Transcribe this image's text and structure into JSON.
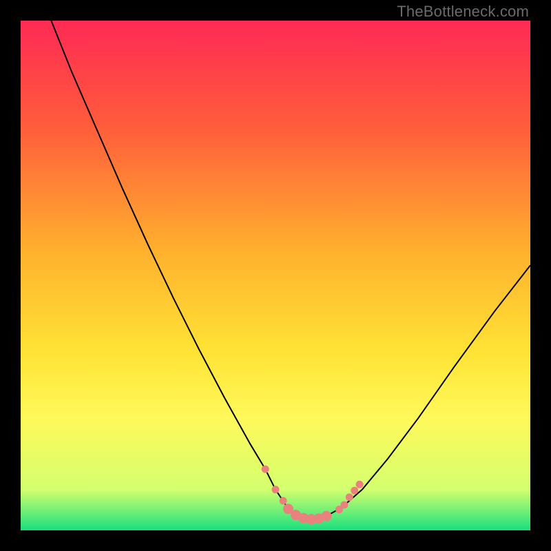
{
  "watermark": "TheBottleneck.com",
  "chart_data": {
    "type": "line",
    "title": "",
    "xlabel": "",
    "ylabel": "",
    "xlim": [
      0,
      100
    ],
    "ylim": [
      0,
      100
    ],
    "gradient_stops": [
      {
        "offset": 0,
        "color": "#ff2a55"
      },
      {
        "offset": 0.2,
        "color": "#ff5a3c"
      },
      {
        "offset": 0.45,
        "color": "#ffb02e"
      },
      {
        "offset": 0.65,
        "color": "#ffe335"
      },
      {
        "offset": 0.78,
        "color": "#fff95a"
      },
      {
        "offset": 0.92,
        "color": "#d4ff6e"
      },
      {
        "offset": 1.0,
        "color": "#18e07e"
      }
    ],
    "series": [
      {
        "name": "bottleneck-curve",
        "style": "thin-black",
        "x": [
          6,
          10,
          15,
          20,
          25,
          30,
          35,
          40,
          45,
          48,
          50,
          52,
          54,
          56,
          58,
          60,
          63,
          67,
          72,
          78,
          85,
          93,
          100
        ],
        "y": [
          100,
          90,
          78.5,
          67,
          56,
          45.5,
          35.5,
          26,
          17,
          12,
          8,
          5,
          3,
          2.3,
          2.2,
          2.8,
          4.5,
          8,
          14,
          22,
          32,
          43,
          52
        ]
      }
    ],
    "markers": {
      "name": "highlight-dots",
      "color": "#e9817e",
      "radius_small": 5.5,
      "radius_large": 7.5,
      "points": [
        {
          "x": 48.0,
          "y": 12.0,
          "r": "small"
        },
        {
          "x": 50.0,
          "y": 8.0,
          "r": "small"
        },
        {
          "x": 51.5,
          "y": 5.8,
          "r": "small"
        },
        {
          "x": 52.5,
          "y": 4.2,
          "r": "large"
        },
        {
          "x": 54.0,
          "y": 3.0,
          "r": "large"
        },
        {
          "x": 55.5,
          "y": 2.4,
          "r": "large"
        },
        {
          "x": 57.0,
          "y": 2.2,
          "r": "large"
        },
        {
          "x": 58.5,
          "y": 2.3,
          "r": "large"
        },
        {
          "x": 60.0,
          "y": 2.8,
          "r": "large"
        },
        {
          "x": 62.5,
          "y": 4.1,
          "r": "small"
        },
        {
          "x": 63.5,
          "y": 5.0,
          "r": "small"
        },
        {
          "x": 64.5,
          "y": 6.5,
          "r": "small"
        },
        {
          "x": 65.5,
          "y": 7.8,
          "r": "small"
        },
        {
          "x": 66.5,
          "y": 9.0,
          "r": "small"
        }
      ]
    },
    "green_band": {
      "y0": 0,
      "y1": 3.5
    }
  }
}
